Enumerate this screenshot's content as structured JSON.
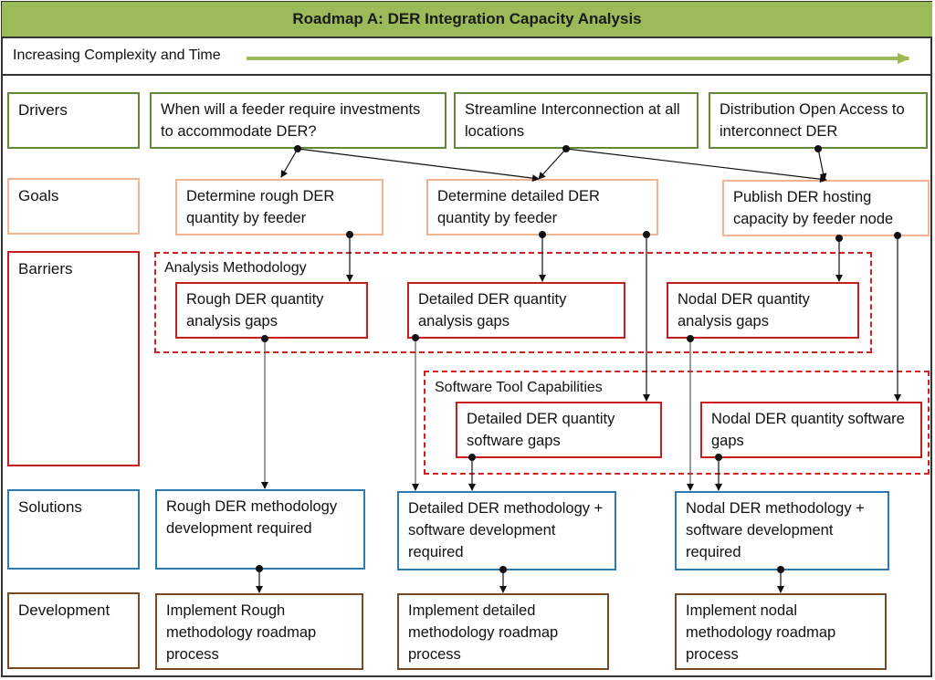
{
  "title": "Roadmap A: DER Integration Capacity Analysis",
  "timeline": {
    "label": "Increasing Complexity and Time"
  },
  "rows": {
    "drivers": "Drivers",
    "goals": "Goals",
    "barriers": "Barriers",
    "solutions": "Solutions",
    "development": "Development"
  },
  "drivers": [
    "When will a feeder require investments to accommodate DER?",
    "Streamline Interconnection at all locations",
    "Distribution Open Access to interconnect DER"
  ],
  "goals": [
    "Determine rough DER quantity by feeder",
    "Determine detailed DER quantity by feeder",
    "Publish DER hosting capacity by feeder node"
  ],
  "barrier_groups": {
    "analysis": {
      "label": "Analysis Methodology",
      "items": [
        "Rough DER quantity analysis gaps",
        "Detailed DER quantity analysis gaps",
        "Nodal DER quantity analysis gaps"
      ]
    },
    "software": {
      "label": "Software Tool Capabilities",
      "items": [
        "Detailed DER quantity software gaps",
        "Nodal DER quantity software gaps"
      ]
    }
  },
  "solutions": [
    "Rough DER methodology development required",
    "Detailed DER methodology  + software development required",
    "Nodal DER methodology + software development required"
  ],
  "development": [
    "Implement Rough methodology roadmap process",
    "Implement detailed methodology roadmap process",
    "Implement nodal methodology roadmap process"
  ],
  "colors": {
    "title_bg": "#9bbb59",
    "drivers": "#5e8a3a",
    "goals": "#f0b58e",
    "barriers": "#c91c1c",
    "solutions": "#2e7bb3",
    "development": "#7a4a22"
  }
}
